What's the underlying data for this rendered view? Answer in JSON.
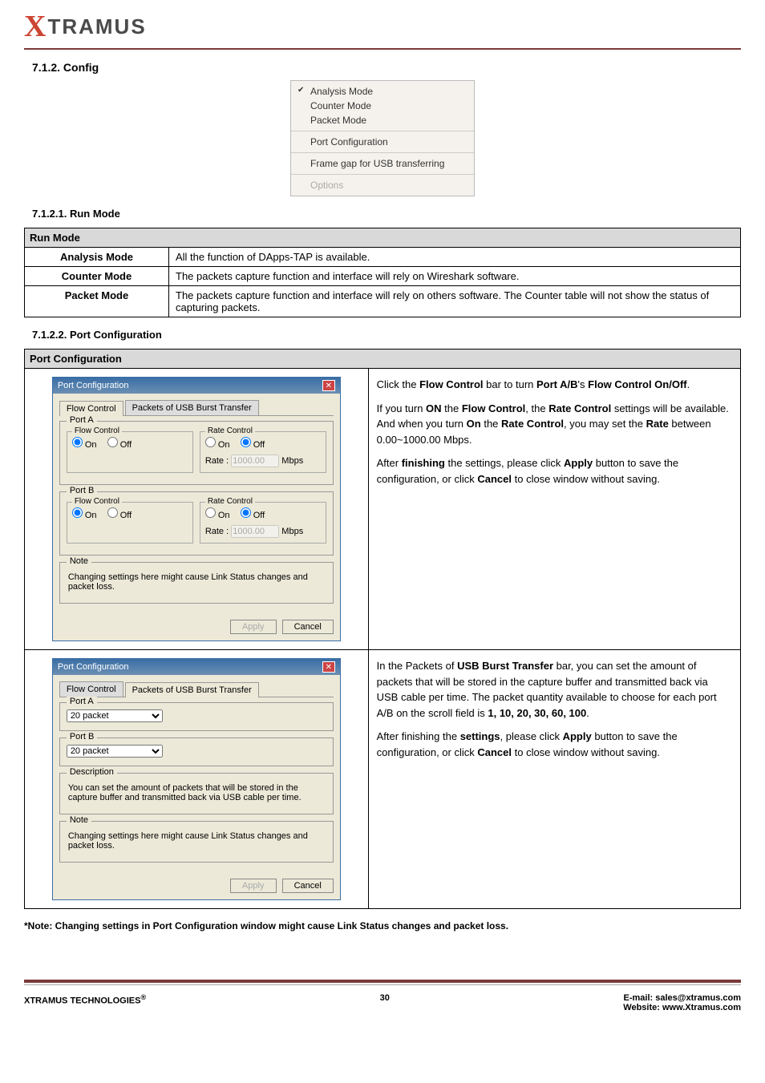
{
  "header": {
    "logo_text": "TRAMUS"
  },
  "sections": {
    "config": "7.1.2. Config",
    "run_mode": "7.1.2.1. Run Mode",
    "port_config": "7.1.2.2. Port Configuration"
  },
  "menu": {
    "group1": {
      "analysis": "Analysis Mode",
      "counter": "Counter Mode",
      "packet": "Packet Mode"
    },
    "group2": {
      "portconf": "Port Configuration"
    },
    "group3": {
      "framegap": "Frame gap for USB transferring"
    },
    "group4": {
      "options": "Options"
    }
  },
  "run_mode_table": {
    "header": "Run Mode",
    "rows": {
      "analysis": {
        "label": "Analysis Mode",
        "desc": "All the function of DApps-TAP is available."
      },
      "counter": {
        "label": "Counter Mode",
        "desc": "The packets capture function and interface will rely on Wireshark software."
      },
      "packet": {
        "label": "Packet Mode",
        "desc": "The packets capture function and interface will rely on others software. The Counter table will not show the status of capturing packets."
      }
    }
  },
  "port_config_table": {
    "header": "Port Configuration"
  },
  "dialog1": {
    "title": "Port Configuration",
    "tab_flow": "Flow Control",
    "tab_packets": "Packets of USB Burst Transfer",
    "port_a": "Port A",
    "port_b": "Port B",
    "flow_control": "Flow Control",
    "rate_control": "Rate Control",
    "on": "On",
    "off": "Off",
    "rate_label": "Rate :",
    "rate_value": "1000.00",
    "mbps": "Mbps",
    "note_title": "Note",
    "note_text": "Changing settings here might cause Link Status changes and packet loss.",
    "apply": "Apply",
    "cancel": "Cancel"
  },
  "dialog2": {
    "title": "Port Configuration",
    "tab_flow": "Flow Control",
    "tab_packets": "Packets of USB Burst Transfer",
    "port_a": "Port A",
    "port_b": "Port B",
    "combo_value": "20 packet",
    "desc_title": "Description",
    "desc_text": "You can set the amount of packets that will be stored in the capture buffer and transmitted back via USB cable per time.",
    "note_title": "Note",
    "note_text": "Changing settings here might cause Link Status changes and packet loss.",
    "apply": "Apply",
    "cancel": "Cancel"
  },
  "explain": {
    "row1_p1a": "Click the ",
    "row1_p1b": "Flow Control",
    "row1_p1c": " bar to turn ",
    "row1_p1d": "Port A/B",
    "row1_p1e": "'s ",
    "row1_p1f": "Flow Control On/Off",
    "row1_p1g": ".",
    "row1_p2a": "If you turn ",
    "row1_p2b": "ON",
    "row1_p2c": " the ",
    "row1_p2d": "Flow Control",
    "row1_p2e": ", the ",
    "row1_p2f": "Rate Control",
    "row1_p2g": " settings will be available. And when you turn ",
    "row1_p2h": "On",
    "row1_p2i": " the ",
    "row1_p2j": "Rate Control",
    "row1_p2k": ", you may set the ",
    "row1_p2l": "Rate",
    "row1_p2m": " between 0.00~1000.00 Mbps.",
    "row1_p3a": "After ",
    "row1_p3b": "finishing",
    "row1_p3c": " the settings, please click ",
    "row1_p3d": "Apply",
    "row1_p3e": " button to save the configuration, or click ",
    "row1_p3f": "Cancel",
    "row1_p3g": " to close window without saving.",
    "row2_p1a": "In the Packets of ",
    "row2_p1b": "USB Burst Transfer",
    "row2_p1c": " bar, you can set the amount of packets that will be stored in the capture buffer and transmitted back via USB cable per time. The packet quantity available to choose for each port A/B on the scroll field is ",
    "row2_p1d": "1, 10, 20, 30, 60, 100",
    "row2_p1e": ".",
    "row2_p2a": "After finishing the ",
    "row2_p2b": "settings",
    "row2_p2c": ", please click ",
    "row2_p2d": "Apply",
    "row2_p2e": " button to save the configuration, or click ",
    "row2_p2f": "Cancel",
    "row2_p2g": " to close window without saving."
  },
  "footnote": "*Note: Changing settings in Port Configuration window might cause Link Status changes and packet loss.",
  "footer": {
    "left": "XTRAMUS TECHNOLOGIES",
    "reg": "®",
    "page": "30",
    "email_label": "E-mail: ",
    "email": "sales@xtramus.com",
    "web_label": "Website:  ",
    "web": "www.Xtramus.com"
  }
}
